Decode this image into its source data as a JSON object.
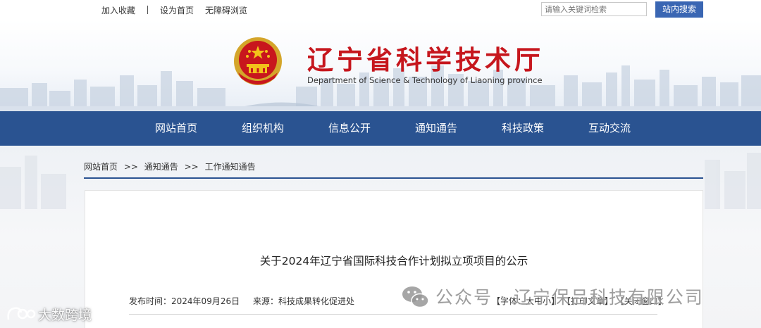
{
  "topbar": {
    "links": [
      "加入收藏",
      "设为首页",
      "无障碍浏览"
    ],
    "search_placeholder": "请输入关键词检索",
    "search_button": "站内搜索"
  },
  "header": {
    "title": "辽宁省科学技术厅",
    "subtitle": "Department of Science & Technology of Liaoning province",
    "emblem_icon": "national-emblem-icon"
  },
  "nav": {
    "items": [
      "网站首页",
      "组织机构",
      "信息公开",
      "通知通告",
      "科技政策",
      "互动交流"
    ]
  },
  "breadcrumb": {
    "home": "网站首页",
    "sep": ">>",
    "level1": "通知通告",
    "level2": "工作通知通告"
  },
  "article": {
    "title": "关于2024年辽宁省国际科技合作计划拟立项项目的公示",
    "publish_label": "发布时间：",
    "publish_date": "2024年09月26日",
    "source_label": "来源：",
    "source": "科技成果转化促进处",
    "font_label": "【字体：",
    "font_large": "大",
    "font_medium": "中",
    "font_small": "小",
    "font_end": "】",
    "print": "【打印文章】",
    "close": "【关闭窗口】"
  },
  "watermarks": {
    "wechat": "公众号 · 辽宁保吕科技有限公司",
    "brand": "大数跨境"
  },
  "colors": {
    "nav_bg": "#2a5391",
    "title_red": "#c6161d",
    "search_button": "#3a66b3"
  }
}
